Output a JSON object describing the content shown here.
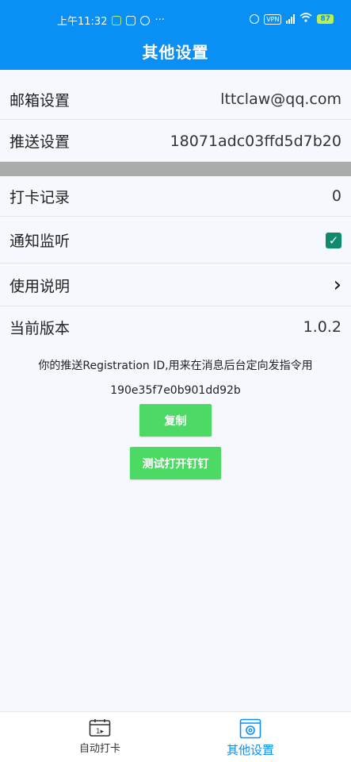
{
  "status_bar": {
    "time": "上午11:32",
    "more": "···",
    "vpn": "VPN",
    "battery": "87"
  },
  "header": {
    "title": "其他设置"
  },
  "settings": {
    "email": {
      "label": "邮箱设置",
      "value": "lttclaw@qq.com"
    },
    "push": {
      "label": "推送设置",
      "value": "18071adc03ffd5d7b20"
    },
    "records": {
      "label": "打卡记录",
      "value": "0"
    },
    "notify": {
      "label": "通知监听",
      "checked": true,
      "check_glyph": "✓"
    },
    "help": {
      "label": "使用说明",
      "chevron": "›"
    },
    "version": {
      "label": "当前版本",
      "value": "1.0.2"
    }
  },
  "info": {
    "text": "你的推送Registration ID,用来在消息后台定向发指令用",
    "registration_id": "190e35f7e0b901dd92b"
  },
  "buttons": {
    "copy": "复制",
    "test": "测试打开钉钉"
  },
  "bottom_nav": {
    "tabs": [
      {
        "label": "自动打卡",
        "icon": "calendar-icon",
        "active": false
      },
      {
        "label": "其他设置",
        "icon": "settings-icon",
        "active": true
      }
    ]
  },
  "colors": {
    "primary": "#0a8ff5",
    "button_green": "#4cd964",
    "checkbox": "#0f8a6d",
    "divider_gray": "#aaabab"
  }
}
